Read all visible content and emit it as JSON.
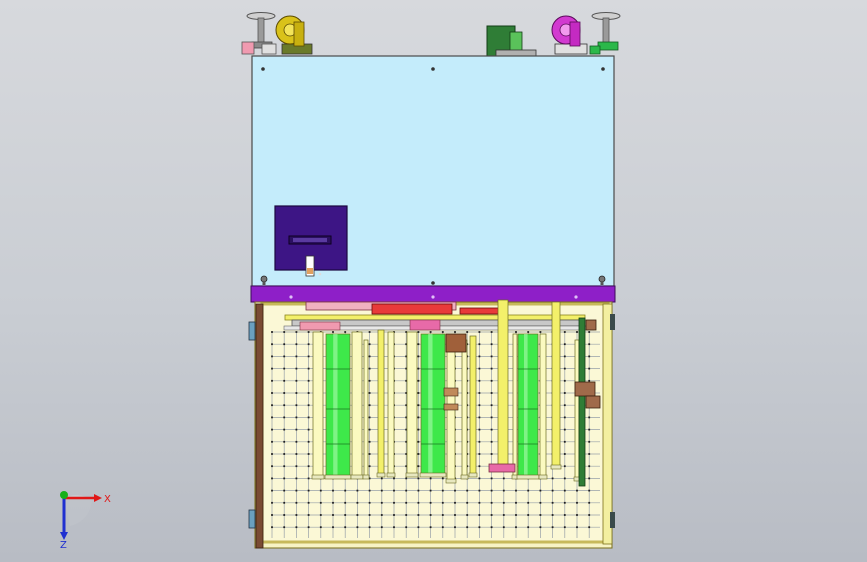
{
  "colors": {
    "background": "#c9cdd3",
    "top_cover": "#c4ecfb",
    "control_box": "#3d1585",
    "purple_band": "#8e1fc8",
    "frame_bg": "#f7f3c4",
    "frame_border": "#c7b95a",
    "grid_line": "#97a0a8",
    "grid_node": "#202020",
    "green_tube": "#3ee84a",
    "yellow_rod": "#f3f06a",
    "pale_rod": "#fbfac0",
    "red_part": "#e83a3a",
    "pink_part": "#e86aa8",
    "brown_side": "#7a4b33",
    "dark_green_post": "#2f7d36",
    "caster_yellow": "#d9c21a",
    "caster_magenta": "#d23ad0",
    "axis_x": "#e01818",
    "axis_y": "#18b018",
    "axis_z": "#2030d0"
  },
  "icons": {
    "triad": "coordinate-triad-icon",
    "leveling_foot": "leveling-foot-icon",
    "caster": "caster-wheel-icon"
  },
  "triad": {
    "x_label": "X",
    "z_label": "Z"
  }
}
